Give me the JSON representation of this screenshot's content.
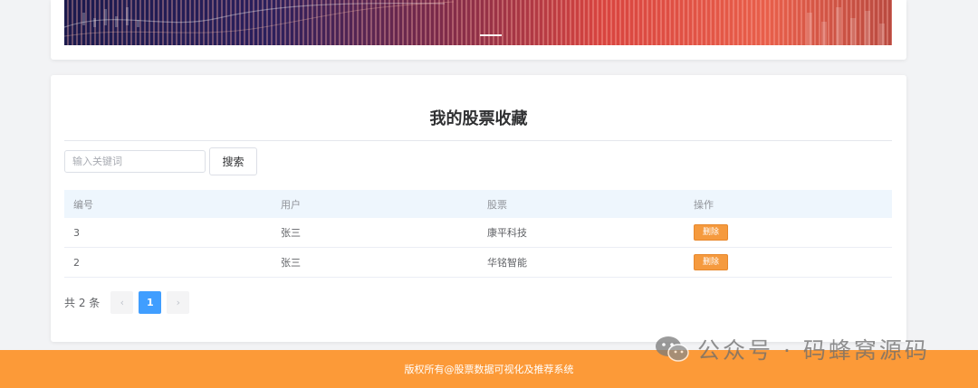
{
  "collection": {
    "title": "我的股票收藏",
    "search_placeholder": "输入关键词",
    "search_button": "搜索",
    "columns": [
      "编号",
      "用户",
      "股票",
      "操作"
    ],
    "rows": [
      {
        "id": "3",
        "user": "张三",
        "stock": "康平科技",
        "action": "删除"
      },
      {
        "id": "2",
        "user": "张三",
        "stock": "华铭智能",
        "action": "删除"
      }
    ],
    "pagination": {
      "total_text": "共 2 条",
      "prev": "‹",
      "current_page": "1",
      "next": "›"
    }
  },
  "footer": {
    "copyright": "版权所有@股票数据可视化及推荐系统"
  },
  "watermark": {
    "text": "公众号 · 码蜂窝源码"
  }
}
